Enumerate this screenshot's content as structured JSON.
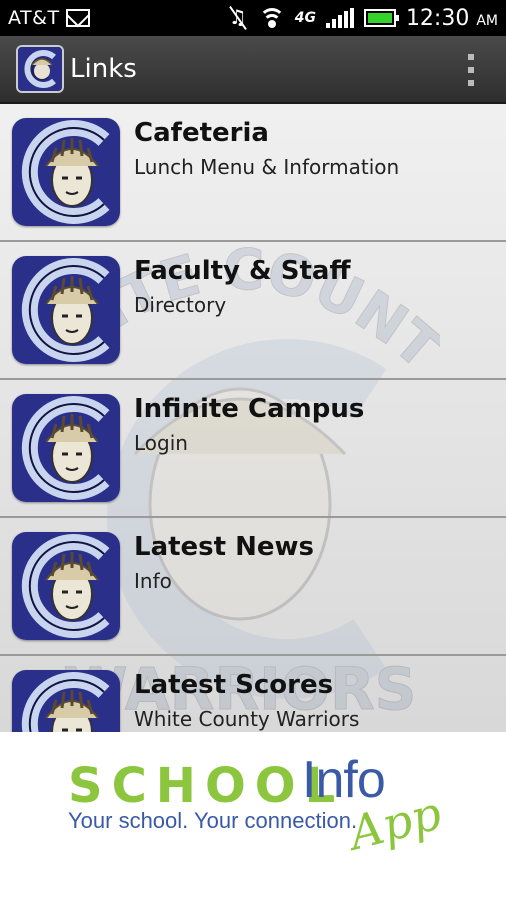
{
  "status_bar": {
    "carrier": "AT&T",
    "network": "4G",
    "time": "12:30",
    "ampm": "AM",
    "icons": [
      "mail-icon",
      "mute-icon",
      "wifi-icon",
      "signal-icon",
      "battery-icon"
    ]
  },
  "action_bar": {
    "title": "Links",
    "logo_icon": "white-county-warriors-logo",
    "overflow_icon": "overflow-menu-icon"
  },
  "links": [
    {
      "title": "Cafeteria",
      "subtitle": "Lunch Menu & Information"
    },
    {
      "title": "Faculty & Staff",
      "subtitle": "Directory"
    },
    {
      "title": "Infinite Campus",
      "subtitle": "Login"
    },
    {
      "title": "Latest News",
      "subtitle": "Info"
    },
    {
      "title": "Latest Scores",
      "subtitle": "White County Warriors"
    }
  ],
  "watermark": {
    "top_text": "WHITE COUNTY",
    "bottom_text": "WARRIORS"
  },
  "footer": {
    "brand_school": "SCHOOL",
    "brand_info": "Info",
    "brand_app": "App",
    "tagline": "Your school. Your connection."
  },
  "colors": {
    "action_bar": "#3a3a3a",
    "logo_navy": "#2a2f8a",
    "brand_green": "#8cc63f",
    "brand_blue": "#3a5aa8"
  }
}
